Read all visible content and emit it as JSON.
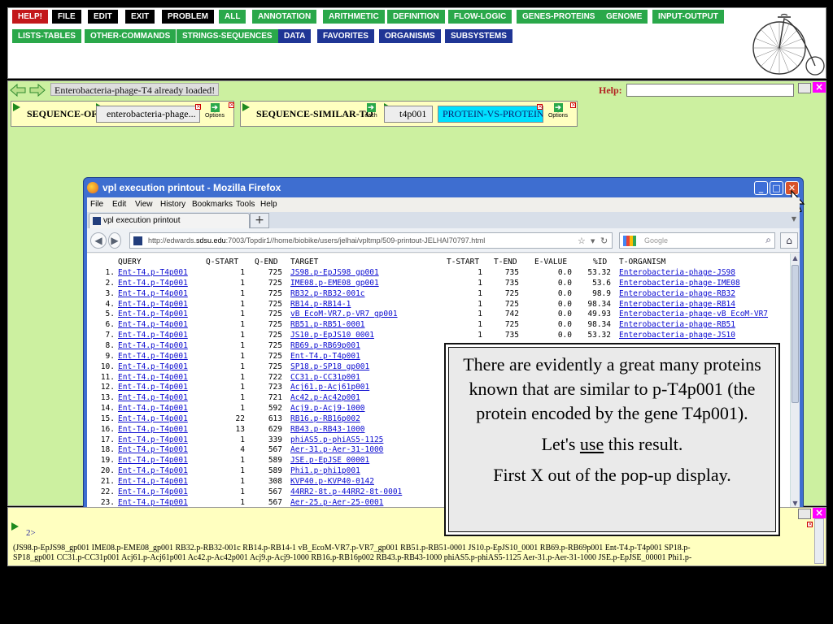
{
  "menu": {
    "row1": [
      {
        "label": "HELP!",
        "color": "red"
      },
      {
        "label": "FILE",
        "color": "black"
      },
      {
        "label": "EDIT",
        "color": "black"
      },
      {
        "label": "EXIT",
        "color": "black"
      },
      {
        "label": "PROBLEM",
        "color": "black"
      },
      {
        "label": "ALL",
        "color": "green"
      },
      {
        "label": "ANNOTATION",
        "color": "green"
      },
      {
        "label": "ARITHMETIC",
        "color": "green"
      },
      {
        "label": "DEFINITION",
        "color": "green"
      },
      {
        "label": "FLOW-LOGIC",
        "color": "green"
      },
      {
        "label": "GENES-PROTEINS",
        "color": "green"
      },
      {
        "label": "GENOME",
        "color": "green"
      },
      {
        "label": "INPUT-OUTPUT",
        "color": "green"
      }
    ],
    "row2": [
      {
        "label": "LISTS-TABLES",
        "color": "green"
      },
      {
        "label": "OTHER-COMMANDS",
        "color": "green"
      },
      {
        "label": "STRINGS-SEQUENCES",
        "color": "green"
      },
      {
        "label": "DATA",
        "color": "blue"
      },
      {
        "label": "FAVORITES",
        "color": "blue"
      },
      {
        "label": "ORGANISMS",
        "color": "blue"
      },
      {
        "label": "SUBSYSTEMS",
        "color": "blue"
      }
    ]
  },
  "workspace": {
    "status": "Enterobacteria-phage-T4 already loaded!",
    "help_label": "Help:",
    "help_value": "",
    "func1": {
      "name": "SEQUENCE-OF",
      "arg": "enterobacteria-phage...",
      "options": "Options"
    },
    "func2": {
      "name": "SEQUENCE-SIMILAR-TO",
      "each": "each",
      "arg": "t4p001",
      "mode": "PROTEIN-VS-PROTEIN",
      "options": "Options"
    }
  },
  "browser": {
    "title": "vpl execution printout - Mozilla Firefox",
    "menus": [
      "File",
      "Edit",
      "View",
      "History",
      "Bookmarks",
      "Tools",
      "Help"
    ],
    "tab_label": "vpl execution printout",
    "url_prefix": "http://edwards.",
    "url_host": "sdsu.edu",
    "url_rest": ":7003/Topdir1//home/biobike/users/jelhai/vpltmp/509-printout-JELHAI70797.html",
    "search_placeholder": "Google"
  },
  "results": {
    "headers": [
      "QUERY",
      "Q-START",
      "Q-END",
      "TARGET",
      "T-START",
      "T-END",
      "E-VALUE",
      "%ID",
      "T-ORGANISM"
    ],
    "rows": [
      {
        "n": "1.",
        "query": "Ent-T4.p-T4p001",
        "qs": "1",
        "qe": "725",
        "target": "JS98.p-EpJS98 gp001",
        "ts": "1",
        "te": "735",
        "ev": "0.0",
        "id": "53.32",
        "org": "Enterobacteria-phage-JS98"
      },
      {
        "n": "2.",
        "query": "Ent-T4.p-T4p001",
        "qs": "1",
        "qe": "725",
        "target": "IME08.p-EME08 gp001",
        "ts": "1",
        "te": "735",
        "ev": "0.0",
        "id": "53.6",
        "org": "Enterobacteria-phage-IME08"
      },
      {
        "n": "3.",
        "query": "Ent-T4.p-T4p001",
        "qs": "1",
        "qe": "725",
        "target": "RB32.p-RB32-001c",
        "ts": "1",
        "te": "725",
        "ev": "0.0",
        "id": "98.9",
        "org": "Enterobacteria-phage-RB32"
      },
      {
        "n": "4.",
        "query": "Ent-T4.p-T4p001",
        "qs": "1",
        "qe": "725",
        "target": "RB14.p-RB14-1",
        "ts": "1",
        "te": "725",
        "ev": "0.0",
        "id": "98.34",
        "org": "Enterobacteria-phage-RB14"
      },
      {
        "n": "5.",
        "query": "Ent-T4.p-T4p001",
        "qs": "1",
        "qe": "725",
        "target": "vB EcoM-VR7.p-VR7 gp001",
        "ts": "1",
        "te": "742",
        "ev": "0.0",
        "id": "49.93",
        "org": "Enterobacteria-phage-vB EcoM-VR7"
      },
      {
        "n": "6.",
        "query": "Ent-T4.p-T4p001",
        "qs": "1",
        "qe": "725",
        "target": "RB51.p-RB51-0001",
        "ts": "1",
        "te": "725",
        "ev": "0.0",
        "id": "98.34",
        "org": "Enterobacteria-phage-RB51"
      },
      {
        "n": "7.",
        "query": "Ent-T4.p-T4p001",
        "qs": "1",
        "qe": "725",
        "target": "JS10.p-EpJS10 0001",
        "ts": "1",
        "te": "735",
        "ev": "0.0",
        "id": "53.32",
        "org": "Enterobacteria-phage-JS10"
      },
      {
        "n": "8.",
        "query": "Ent-T4.p-T4p001",
        "qs": "1",
        "qe": "725",
        "target": "RB69.p-RB69p001",
        "ts": "",
        "te": "",
        "ev": "",
        "id": "",
        "org": ""
      },
      {
        "n": "9.",
        "query": "Ent-T4.p-T4p001",
        "qs": "1",
        "qe": "725",
        "target": "Ent-T4.p-T4p001",
        "ts": "",
        "te": "",
        "ev": "",
        "id": "",
        "org": ""
      },
      {
        "n": "10.",
        "query": "Ent-T4.p-T4p001",
        "qs": "1",
        "qe": "725",
        "target": "SP18.p-SP18 gp001",
        "ts": "",
        "te": "",
        "ev": "",
        "id": "",
        "org": ""
      },
      {
        "n": "11.",
        "query": "Ent-T4.p-T4p001",
        "qs": "1",
        "qe": "722",
        "target": "CC31.p-CC31p001",
        "ts": "",
        "te": "",
        "ev": "",
        "id": "",
        "org": ""
      },
      {
        "n": "12.",
        "query": "Ent-T4.p-T4p001",
        "qs": "1",
        "qe": "723",
        "target": "Acj61.p-Acj61p001",
        "ts": "",
        "te": "",
        "ev": "",
        "id": "",
        "org": ""
      },
      {
        "n": "13.",
        "query": "Ent-T4.p-T4p001",
        "qs": "1",
        "qe": "721",
        "target": "Ac42.p-Ac42p001",
        "ts": "",
        "te": "",
        "ev": "",
        "id": "",
        "org": ""
      },
      {
        "n": "14.",
        "query": "Ent-T4.p-T4p001",
        "qs": "1",
        "qe": "592",
        "target": "Acj9.p-Acj9-1000",
        "ts": "",
        "te": "",
        "ev": "",
        "id": "",
        "org": ""
      },
      {
        "n": "15.",
        "query": "Ent-T4.p-T4p001",
        "qs": "22",
        "qe": "613",
        "target": "RB16.p-RB16p002",
        "ts": "",
        "te": "",
        "ev": "",
        "id": "",
        "org": ""
      },
      {
        "n": "16.",
        "query": "Ent-T4.p-T4p001",
        "qs": "13",
        "qe": "629",
        "target": "RB43.p-RB43-1000",
        "ts": "",
        "te": "",
        "ev": "",
        "id": "",
        "org": ""
      },
      {
        "n": "17.",
        "query": "Ent-T4.p-T4p001",
        "qs": "1",
        "qe": "339",
        "target": "phiAS5.p-phiAS5-1125",
        "ts": "",
        "te": "",
        "ev": "",
        "id": "",
        "org": ""
      },
      {
        "n": "18.",
        "query": "Ent-T4.p-T4p001",
        "qs": "4",
        "qe": "567",
        "target": "Aer-31.p-Aer-31-1000",
        "ts": "",
        "te": "",
        "ev": "",
        "id": "",
        "org": ""
      },
      {
        "n": "19.",
        "query": "Ent-T4.p-T4p001",
        "qs": "1",
        "qe": "589",
        "target": "JSE.p-EpJSE 00001",
        "ts": "",
        "te": "",
        "ev": "",
        "id": "",
        "org": ""
      },
      {
        "n": "20.",
        "query": "Ent-T4.p-T4p001",
        "qs": "1",
        "qe": "589",
        "target": "Phi1.p-phi1p001",
        "ts": "",
        "te": "",
        "ev": "",
        "id": "",
        "org": ""
      },
      {
        "n": "21.",
        "query": "Ent-T4.p-T4p001",
        "qs": "1",
        "qe": "308",
        "target": "KVP40.p-KVP40-0142",
        "ts": "",
        "te": "",
        "ev": "",
        "id": "",
        "org": ""
      },
      {
        "n": "22.",
        "query": "Ent-T4.p-T4p001",
        "qs": "1",
        "qe": "567",
        "target": "44RR2-8t.p-44RR2-8t-0001",
        "ts": "",
        "te": "",
        "ev": "",
        "id": "",
        "org": ""
      },
      {
        "n": "23.",
        "query": "Ent-T4.p-T4p001",
        "qs": "1",
        "qe": "567",
        "target": "Aer-25.p-Aer-25-0001",
        "ts": "",
        "te": "",
        "ev": "",
        "id": "",
        "org": ""
      }
    ]
  },
  "callout": {
    "p1": "There are evidently a great many proteins known that are similar to p-T4p001 (the protein encoded by the gene T4p001).",
    "p2_before": "Let's ",
    "p2_use": "use",
    "p2_after": " this result.",
    "p3": "First X out of the pop-up display."
  },
  "output": {
    "index": "2>",
    "line1": "(JS98.p-EpJS98_gp001 IME08.p-EME08_gp001 RB32.p-RB32-001c RB14.p-RB14-1 vB_EcoM-VR7.p-VR7_gp001 RB51.p-RB51-0001 JS10.p-EpJS10_0001 RB69.p-RB69p001 Ent-T4.p-T4p001 SP18.p-",
    "line2": "SP18_gp001 CC31.p-CC31p001 Acj61.p-Acj61p001 Ac42.p-Ac42p001 Acj9.p-Acj9-1000 RB16.p-RB16p002 RB43.p-RB43-1000 phiAS5.p-phiAS5-1125 Aer-31.p-Aer-31-1000 JSE.p-EpJSE_00001 Phi1.p-"
  }
}
